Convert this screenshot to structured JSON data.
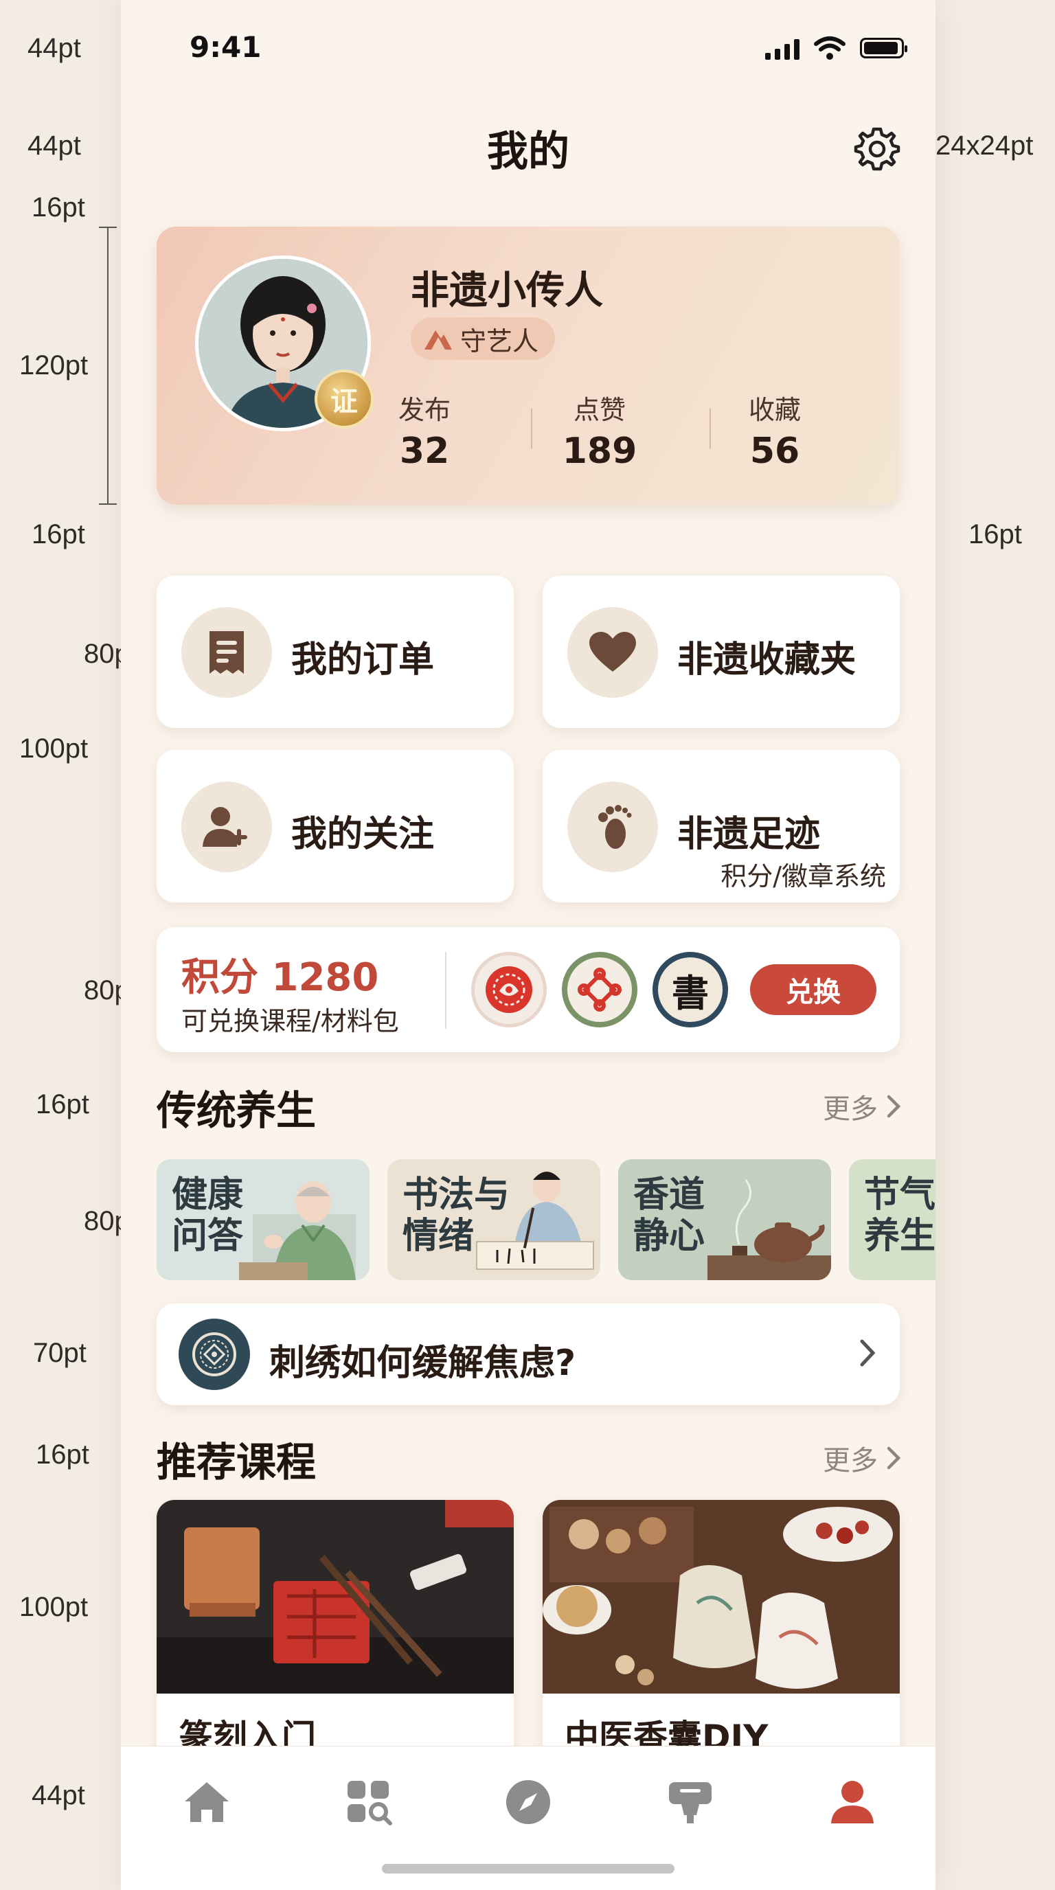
{
  "annotations": {
    "status_bar_h": "44pt",
    "nav_bar_h": "44pt",
    "settings_size": "24x24pt",
    "gap_top": "16pt",
    "profile_h": "120pt",
    "avatar_size": "70x70pt",
    "gap_left": "16pt",
    "gap_right": "16pt",
    "menu_w": "165pt",
    "menu_h": "80pt",
    "menu_rows_h": "100pt",
    "points_h": "80pt",
    "section_gap": "16pt",
    "wellness_w": "150pt",
    "wellness_h": "80pt",
    "qa_h": "70pt",
    "section_gap2": "16pt",
    "course_w": "160pt",
    "course_h": "100pt",
    "tabbar_h": "44pt"
  },
  "status_bar": {
    "time": "9:41"
  },
  "header": {
    "title": "我的"
  },
  "profile": {
    "name": "非遗小传人",
    "role": "守艺人",
    "cert_badge": "证",
    "stats": [
      {
        "label": "发布",
        "value": "32"
      },
      {
        "label": "点赞",
        "value": "189"
      },
      {
        "label": "收藏",
        "value": "56"
      }
    ]
  },
  "menu": {
    "orders": "我的订单",
    "favorites": "非遗收藏夹",
    "following": "我的关注",
    "footprints": "非遗足迹",
    "footprints_sub": "积分/徽章系统"
  },
  "points": {
    "title": "积分 1280",
    "subtitle": "可兑换课程/材料包",
    "badge3_char": "書",
    "redeem": "兑换"
  },
  "wellness": {
    "title": "传统养生",
    "more": "更多",
    "cards": [
      {
        "line1": "健康",
        "line2": "问答"
      },
      {
        "line1": "书法与",
        "line2": "情绪"
      },
      {
        "line1": "香道",
        "line2": "静心"
      },
      {
        "line1": "节气",
        "line2": "养生"
      }
    ]
  },
  "qa": {
    "question": "刺绣如何缓解焦虑?"
  },
  "courses": {
    "title": "推荐课程",
    "more": "更多",
    "items": [
      {
        "title": "篆刻入门"
      },
      {
        "title": "中医香囊DIY"
      }
    ]
  },
  "colors": {
    "accent": "#c94a3b",
    "background": "#fbf4ec",
    "card": "#ffffff",
    "icon_brown": "#6b4a3a"
  }
}
